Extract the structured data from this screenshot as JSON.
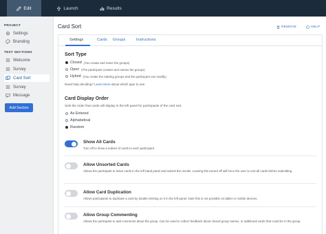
{
  "topnav": {
    "tabs": [
      {
        "label": "Edit",
        "icon": "edit-icon",
        "active": true
      },
      {
        "label": "Launch",
        "icon": "launch-icon",
        "active": false
      },
      {
        "label": "Results",
        "icon": "results-icon",
        "active": false
      }
    ]
  },
  "sidebar": {
    "project_heading": "PROJECT",
    "project_items": [
      {
        "label": "Settings",
        "icon": "gear-icon"
      },
      {
        "label": "Branding",
        "icon": "palette-icon"
      }
    ],
    "sections_heading": "TEST SECTIONS",
    "section_items": [
      {
        "label": "Welcome",
        "icon": "welcome-icon",
        "active": false
      },
      {
        "label": "Survey",
        "icon": "survey-icon",
        "active": false
      },
      {
        "label": "Card Sort",
        "icon": "card-sort-icon",
        "active": true
      },
      {
        "label": "Survey",
        "icon": "survey-icon",
        "active": false
      },
      {
        "label": "Message",
        "icon": "message-icon",
        "active": false
      }
    ],
    "add_section_label": "Add Section"
  },
  "main": {
    "title": "Card Sort",
    "remove_label": "REMOVE",
    "help_label": "HELP",
    "subtabs": [
      "Settings",
      "Cards",
      "Groups",
      "Instructions"
    ],
    "sort_type": {
      "heading": "Sort Type",
      "options": [
        {
          "label": "Closed",
          "desc": "(You create and name the groups)",
          "selected": true
        },
        {
          "label": "Open",
          "desc": "(The participant creates and names the groups)",
          "selected": false
        },
        {
          "label": "Hybrid",
          "desc": "(You create the starting groups and the participant can modify)",
          "selected": false
        }
      ],
      "help_prefix": "Need help deciding?",
      "help_link": "Learn More",
      "help_suffix": "about which type to use."
    },
    "display_order": {
      "heading": "Card Display Order",
      "desc": "Sets the order that cards will display in the left panel for participants of the card sort.",
      "options": [
        {
          "label": "As Entered",
          "selected": false
        },
        {
          "label": "Alphabetical",
          "selected": false
        },
        {
          "label": "Random",
          "selected": true
        }
      ]
    },
    "toggles": [
      {
        "title": "Show All Cards",
        "on": true,
        "desc": "Turn off to show a subset of cards to each participant."
      },
      {
        "title": "Allow Unsorted Cards",
        "on": false,
        "desc": "Allows the participant to leave cards in the left hand panel and submit the results. Leaving this turned off will force the user to sort all cards before submitting."
      },
      {
        "title": "Allow Card Duplication",
        "on": false,
        "desc": "Allows participants to duplicate a card by double-clicking on it in the left panel. Note this is not possible on tablet or mobile devices."
      },
      {
        "title": "Allow Group Commenting",
        "on": false,
        "desc": "Allows the participant to add comments about the group. Can be used to collect feedback about closed group names, or additional cards that could be in the group."
      }
    ]
  },
  "colors": {
    "topbar": "#1c2b3a",
    "accent": "#2f6fd6",
    "active_tab": "#42586f"
  }
}
